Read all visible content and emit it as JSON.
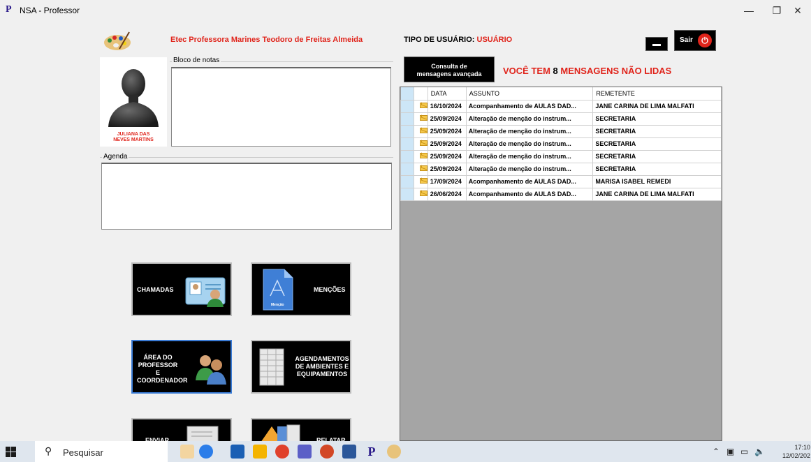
{
  "window": {
    "title": "NSA - Professor",
    "minimize": "—",
    "restore": "❐",
    "close": "✕"
  },
  "header": {
    "school": "Etec Professora Marines Teodoro de Freitas Almeida",
    "user_type_label": "TIPO DE USUÁRIO:",
    "user_type_value": "USUÁRIO",
    "exit_label": "Sair"
  },
  "profile": {
    "name_line1": "JULIANA DAS",
    "name_line2": "NEVES MARTINS"
  },
  "notes": {
    "label": "Bloco de notas"
  },
  "agenda": {
    "label": "Agenda"
  },
  "messages": {
    "consulta_line1": "Consulta de",
    "consulta_line2": "mensagens avançada",
    "unread_prefix": "VOCÊ TEM",
    "unread_count": "8",
    "unread_suffix": "MENSAGENS NÃO LIDAS",
    "columns": [
      "DATA",
      "ASSUNTO",
      "REMETENTE"
    ],
    "rows": [
      {
        "date": "16/10/2024",
        "subject": "Acompanhamento de AULAS DAD...",
        "sender": "JANE CARINA DE LIMA MALFATI"
      },
      {
        "date": "25/09/2024",
        "subject": "Alteração de menção do instrum...",
        "sender": "SECRETARIA"
      },
      {
        "date": "25/09/2024",
        "subject": "Alteração de menção do instrum...",
        "sender": "SECRETARIA"
      },
      {
        "date": "25/09/2024",
        "subject": "Alteração de menção do instrum...",
        "sender": "SECRETARIA"
      },
      {
        "date": "25/09/2024",
        "subject": "Alteração de menção do instrum...",
        "sender": "SECRETARIA"
      },
      {
        "date": "25/09/2024",
        "subject": "Alteração de menção do instrum...",
        "sender": "SECRETARIA"
      },
      {
        "date": "17/09/2024",
        "subject": "Acompanhamento de AULAS DAD...",
        "sender": "MARISA ISABEL REMEDI"
      },
      {
        "date": "26/06/2024",
        "subject": "Acompanhamento de AULAS DAD...",
        "sender": "JANE CARINA DE LIMA MALFATI"
      }
    ]
  },
  "buttons": {
    "chamadas": "CHAMADAS",
    "mencoes": "MENÇÕES",
    "area_line1": "ÁREA DO",
    "area_line2": "PROFESSOR E",
    "area_line3": "COORDENADOR",
    "agend_line1": "AGENDAMENTOS",
    "agend_line2": "DE AMBIENTES E",
    "agend_line3": "EQUIPAMENTOS",
    "enviar": "ENVIAR",
    "relatar": "RELATAR"
  },
  "taskbar": {
    "search_placeholder": "Pesquisar",
    "time": "17:10",
    "date": "12/02/202"
  },
  "colors": {
    "accent_red": "#e0241b",
    "button_black": "#000000",
    "grid_gray": "#a5a5a5"
  }
}
